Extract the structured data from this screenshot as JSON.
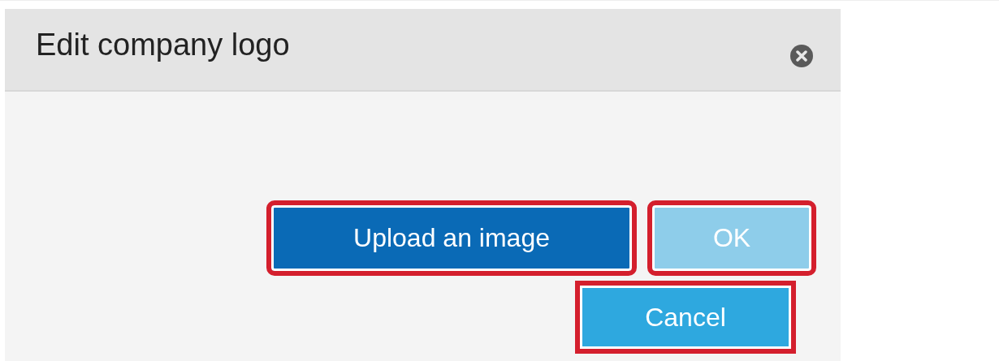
{
  "dialog": {
    "title": "Edit company logo",
    "buttons": [
      {
        "label": "Upload an image",
        "kind": "primary",
        "highlighted": true,
        "disabled": false
      },
      {
        "label": "OK",
        "kind": "primary",
        "highlighted": true,
        "disabled": true
      },
      {
        "label": "Cancel",
        "kind": "secondary",
        "highlighted": true,
        "disabled": false
      }
    ]
  }
}
